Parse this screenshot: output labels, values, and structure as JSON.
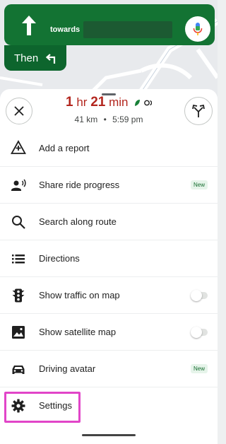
{
  "banner": {
    "towards_label": "towards",
    "then_label": "Then",
    "direction_icon": "arrow-up-icon",
    "then_icon": "turn-left-icon",
    "mic_icon": "mic-icon",
    "color": "#137333"
  },
  "trip": {
    "eta_hours": "1",
    "eta_hours_unit": "hr",
    "eta_minutes": "21",
    "eta_minutes_unit": "min",
    "distance": "41 km",
    "separator": "•",
    "arrival": "5:59 pm",
    "eta_color": "#b3261e"
  },
  "menu": {
    "items": [
      {
        "label": "Add a report",
        "icon": "add-report-icon"
      },
      {
        "label": "Share ride progress",
        "icon": "share-progress-icon",
        "badge": "New"
      },
      {
        "label": "Search along route",
        "icon": "search-icon"
      },
      {
        "label": "Directions",
        "icon": "list-icon"
      },
      {
        "label": "Show traffic on map",
        "icon": "traffic-light-icon",
        "toggle": false
      },
      {
        "label": "Show satellite map",
        "icon": "image-icon",
        "toggle": false
      },
      {
        "label": "Driving avatar",
        "icon": "car-icon",
        "badge": "New"
      },
      {
        "label": "Settings",
        "icon": "gear-icon"
      }
    ]
  },
  "highlight_color": "#e145c8"
}
